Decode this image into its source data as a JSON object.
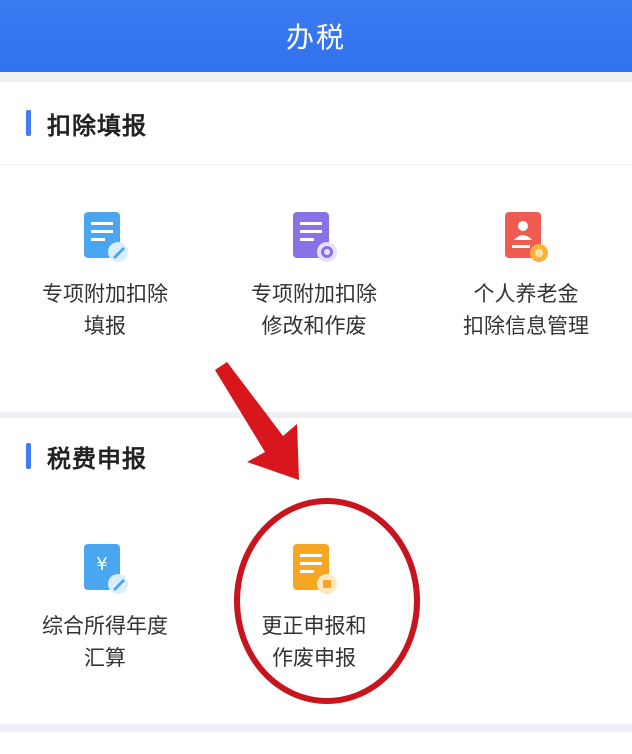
{
  "header": {
    "title": "办税"
  },
  "sections": [
    {
      "title": "扣除填报",
      "items": [
        {
          "line1": "专项附加扣除",
          "line2": "填报",
          "icon": "document-edit-icon",
          "color": "#4aa6ee"
        },
        {
          "line1": "专项附加扣除",
          "line2": "修改和作废",
          "icon": "document-settings-icon",
          "color": "#8a72e6"
        },
        {
          "line1": "个人养老金",
          "line2": "扣除信息管理",
          "icon": "pension-card-icon",
          "color": "#ee5b50"
        }
      ]
    },
    {
      "title": "税费申报",
      "items": [
        {
          "line1": "综合所得年度",
          "line2": "汇算",
          "icon": "yuan-document-icon",
          "color": "#4aa6ee"
        },
        {
          "line1": "更正申报和",
          "line2": "作废申报",
          "icon": "correction-document-icon",
          "color": "#f5a623"
        }
      ]
    }
  ],
  "annotation_colors": {
    "arrow": "#d9161c",
    "circle": "#c8141c"
  }
}
